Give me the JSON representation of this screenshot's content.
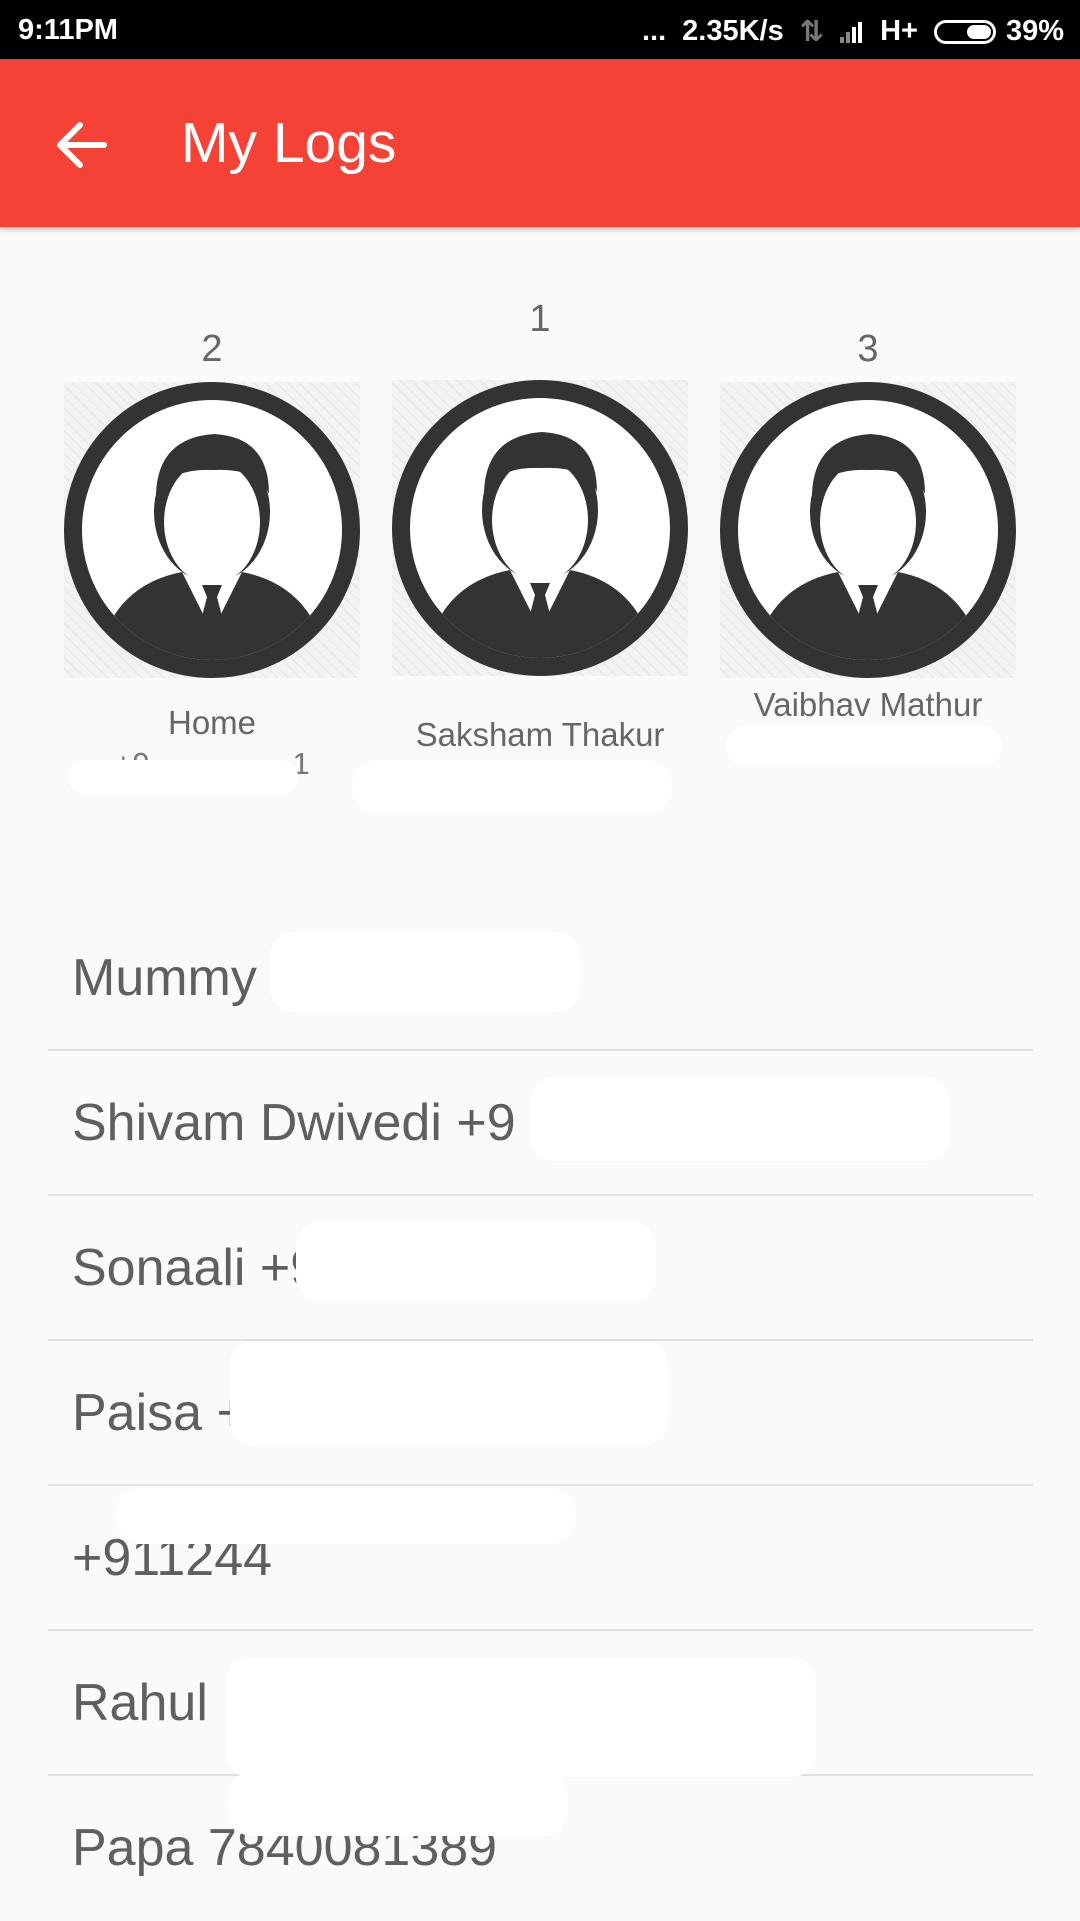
{
  "status_bar": {
    "time": "9:11PM",
    "dots": "...",
    "network_speed": "2.35K/s",
    "network_type": "H+",
    "battery": "39%"
  },
  "app_bar": {
    "title": "My Logs",
    "back_icon": "arrow-back-icon"
  },
  "top_contacts": [
    {
      "rank": "2",
      "name": "Home",
      "number": "+9· · · · · · · ·1"
    },
    {
      "rank": "1",
      "name": "Saksham Thakur",
      "number": ""
    },
    {
      "rank": "3",
      "name": "Vaibhav Mathur",
      "number": ""
    }
  ],
  "logs": [
    {
      "text": "Mummy +91"
    },
    {
      "text": "Shivam Dwivedi +9"
    },
    {
      "text": "Sonaali +919"
    },
    {
      "text": "Paisa +91"
    },
    {
      "text": "+911244"
    },
    {
      "text": "Rahul Bhaiya +91"
    },
    {
      "text": "Papa 7840081389"
    }
  ],
  "colors": {
    "app_bar": "#f44336",
    "status_bar": "#000000",
    "background": "#fafafa",
    "avatar": "#333333"
  }
}
